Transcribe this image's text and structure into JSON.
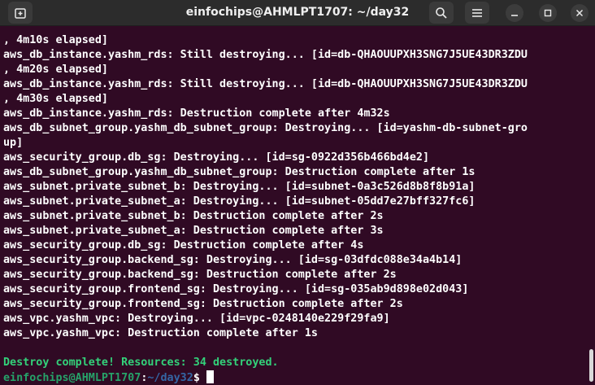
{
  "window": {
    "title": "einfochips@AHMLPT1707: ~/day32",
    "icons": {
      "new_tab": "new-tab-icon",
      "search": "search-icon",
      "menu": "hamburger-menu-icon",
      "minimize": "minimize-icon",
      "maximize": "maximize-icon",
      "close": "close-icon"
    }
  },
  "terminal": {
    "lines": [
      ", 4m10s elapsed]",
      "aws_db_instance.yashm_rds: Still destroying... [id=db-QHAOUUPXH3SNG7J5UE43DR3ZDU",
      ", 4m20s elapsed]",
      "aws_db_instance.yashm_rds: Still destroying... [id=db-QHAOUUPXH3SNG7J5UE43DR3ZDU",
      ", 4m30s elapsed]",
      "aws_db_instance.yashm_rds: Destruction complete after 4m32s",
      "aws_db_subnet_group.yashm_db_subnet_group: Destroying... [id=yashm-db-subnet-gro",
      "up]",
      "aws_security_group.db_sg: Destroying... [id=sg-0922d356b466bd4e2]",
      "aws_db_subnet_group.yashm_db_subnet_group: Destruction complete after 1s",
      "aws_subnet.private_subnet_b: Destroying... [id=subnet-0a3c526d8b8f8b91a]",
      "aws_subnet.private_subnet_a: Destroying... [id=subnet-05dd7e27bff327fc6]",
      "aws_subnet.private_subnet_b: Destruction complete after 2s",
      "aws_subnet.private_subnet_a: Destruction complete after 3s",
      "aws_security_group.db_sg: Destruction complete after 4s",
      "aws_security_group.backend_sg: Destroying... [id=sg-03dfdc088e34a4b14]",
      "aws_security_group.backend_sg: Destruction complete after 2s",
      "aws_security_group.frontend_sg: Destroying... [id=sg-035ab9d898e02d043]",
      "aws_security_group.frontend_sg: Destruction complete after 2s",
      "aws_vpc.yashm_vpc: Destroying... [id=vpc-0248140e229f29fa9]",
      "aws_vpc.yashm_vpc: Destruction complete after 1s"
    ],
    "blank_line": "",
    "success_message": "Destroy complete! Resources: 34 destroyed.",
    "prompt": {
      "user_host": "einfochips@AHMLPT1707",
      "separator": ":",
      "path": "~/day32",
      "symbol": "$ "
    }
  },
  "colors": {
    "background": "#300a24",
    "titlebar": "#2c2c2c",
    "text": "#ffffff",
    "success": "#33d17a",
    "prompt_user": "#26a269",
    "prompt_path": "#3465a4"
  }
}
